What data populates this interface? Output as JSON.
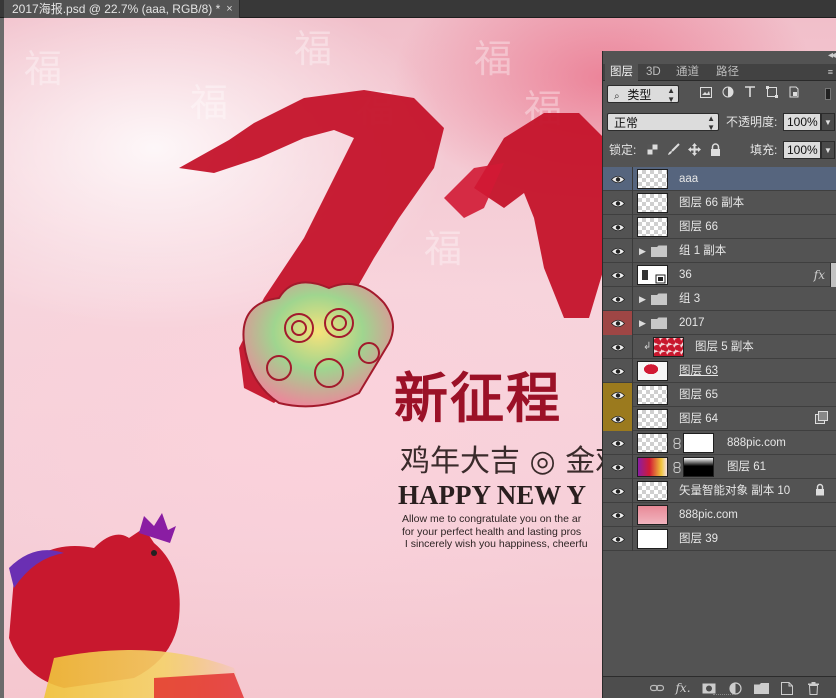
{
  "document_tab": {
    "title": "2017海报.psd @ 22.7% (aaa, RGB/8) *",
    "close": "×"
  },
  "canvas": {
    "background_text": [
      "福",
      "福",
      "福",
      "福",
      "福",
      "福",
      "福"
    ],
    "headline": "新征程",
    "sub_headline": "鸡年大吉 ◎ 金鸡",
    "happy_text": "HAPPY NEW Y",
    "blurb": "Allow me to congratulate you on the ar\nfor your perfect health and lasting pros\n I sincerely wish you happiness, cheerfu",
    "colors": {
      "red": "#c4132a",
      "dark_red": "#9b1127"
    }
  },
  "layers_panel": {
    "collapse": "◂◂",
    "tabs": [
      "图层",
      "3D",
      "通道",
      "路径"
    ],
    "active_tab": 0,
    "tab_menu": "≡",
    "filter": {
      "kind": "类型"
    },
    "blend_mode": "正常",
    "opacity_label": "不透明度:",
    "opacity_value": "100%",
    "lock_label": "锁定:",
    "fill_label": "填充:",
    "fill_value": "100%",
    "layers": [
      {
        "name": "aaa",
        "selected": true,
        "eye": "normal",
        "thumb": "transparent"
      },
      {
        "name": "图层 66 副本",
        "eye": "normal",
        "thumb": "transparent"
      },
      {
        "name": "图层 66",
        "eye": "normal",
        "thumb": "transparent"
      },
      {
        "name": "组 1 副本",
        "eye": "normal",
        "group": true
      },
      {
        "name": "36",
        "eye": "normal",
        "thumb": "smart",
        "fx": "fx"
      },
      {
        "name": "组 3",
        "eye": "normal",
        "group": true
      },
      {
        "name": "2017",
        "eye": "red",
        "group": true
      },
      {
        "name": "图层 5 副本",
        "eye": "normal",
        "thumb": "red-texture",
        "clipped": true
      },
      {
        "name": "图层 63",
        "eye": "normal",
        "thumb": "red-blob",
        "underline": true
      },
      {
        "name": "图层 65",
        "eye": "gold",
        "thumb": "transparent"
      },
      {
        "name": "图层 64",
        "eye": "gold",
        "thumb": "transparent",
        "badge": "copy"
      },
      {
        "name": "888pic.com",
        "eye": "normal",
        "thumb": "transparent",
        "mask": "white"
      },
      {
        "name": "图层 61",
        "eye": "normal",
        "thumb": "colorful",
        "mask": "black-gradient"
      },
      {
        "name": "矢量智能对象 副本 10",
        "eye": "normal",
        "thumb": "transparent",
        "badge": "lock"
      },
      {
        "name": "888pic.com",
        "eye": "normal",
        "thumb": "pink"
      },
      {
        "name": "图层 39",
        "eye": "normal",
        "thumb": "white"
      }
    ],
    "footer_icons": [
      "link-icon",
      "fx-icon",
      "mask-icon",
      "adjustment-icon",
      "folder-icon",
      "new-layer-icon",
      "trash-icon"
    ]
  }
}
